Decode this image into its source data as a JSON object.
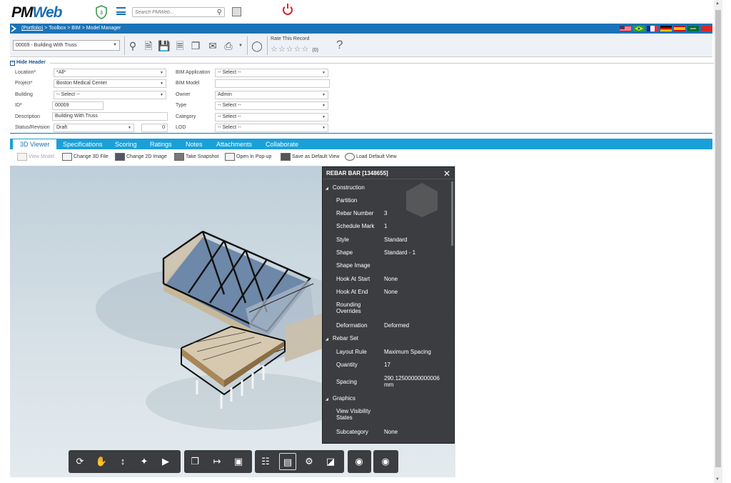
{
  "app": {
    "logo_text_a": "PM",
    "logo_text_b": "Web",
    "shield_count": "3",
    "search_placeholder": "Search PMWeb..."
  },
  "breadcrumb": {
    "portfolio": "(Portfolio)",
    "rest": " > Toolbox > BIM > Model Manager"
  },
  "record": {
    "selector": "00009 - Building With Truss",
    "rate_label": "Rate This Record",
    "rating_count": "(0)"
  },
  "header": {
    "hide_label": "Hide Header",
    "fields": {
      "location_label": "Location*",
      "location_value": "*All*",
      "project_label": "Project*",
      "project_value": "Boston Medical Center",
      "building_label": "Building",
      "building_value": "-- Select --",
      "id_label": "ID*",
      "id_value": "00009",
      "description_label": "Description",
      "description_value": "Building With Truss",
      "status_label": "Status/Revision",
      "status_value": "Draft",
      "revision_value": "0",
      "bim_app_label": "BIM Application",
      "bim_app_value": "-- Select --",
      "bim_model_label": "BIM Model",
      "bim_model_value": "",
      "owner_label": "Owner",
      "owner_value": "Admin",
      "type_label": "Type",
      "type_value": "-- Select --",
      "category_label": "Category",
      "category_value": "-- Select --",
      "lod_label": "LOD",
      "lod_value": "-- Select --"
    }
  },
  "tabs": [
    "3D Viewer",
    "Specifications",
    "Scoring",
    "Ratings",
    "Notes",
    "Attachments",
    "Collaborate"
  ],
  "subtoolbar": {
    "view_model": "View Model",
    "change_3d": "Change 3D File",
    "change_2d": "Change 2D Image",
    "snapshot": "Take Snapshot",
    "popup": "Open In Pop-up",
    "save_default": "Save as Default View",
    "load_default": "Load Default View"
  },
  "panel": {
    "title": "REBAR BAR [1348655]",
    "sections": {
      "construction": "Construction",
      "rebar_set": "Rebar Set",
      "graphics": "Graphics"
    },
    "rows": [
      {
        "k": "Partition",
        "v": ""
      },
      {
        "k": "Rebar Number",
        "v": "3"
      },
      {
        "k": "Schedule Mark",
        "v": "1"
      },
      {
        "k": "Style",
        "v": "Standard"
      },
      {
        "k": "Shape",
        "v": "Standard - 1"
      },
      {
        "k": "Shape Image",
        "v": ""
      },
      {
        "k": "Hook At Start",
        "v": "None"
      },
      {
        "k": "Hook At End",
        "v": "None"
      },
      {
        "k": "Rounding Overrides",
        "v": ""
      },
      {
        "k": "Deformation",
        "v": "Deformed"
      },
      {
        "k": "Layout Rule",
        "v": "Maximum Spacing"
      },
      {
        "k": "Quantity",
        "v": "17"
      },
      {
        "k": "Spacing",
        "v": "290.12500000000006 mm"
      },
      {
        "k": "View Visibility States",
        "v": ""
      },
      {
        "k": "Subcategory",
        "v": "None"
      }
    ]
  },
  "colors": {
    "brand_blue": "#1a73b8",
    "tab_blue": "#1aa0d8",
    "panel_bg": "#3b3d40",
    "power_red": "#d9232e"
  }
}
